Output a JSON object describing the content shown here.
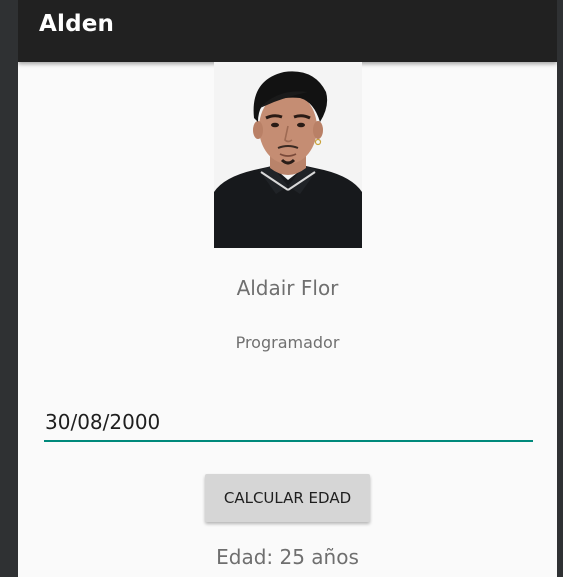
{
  "appbar": {
    "title": "Alden"
  },
  "profile": {
    "name": "Aldair Flor",
    "role": "Programador"
  },
  "form": {
    "birthdate_value": "30/08/2000",
    "calculate_label": "CALCULAR EDAD"
  },
  "result": {
    "text": "Edad: 25 años"
  },
  "colors": {
    "appbar_background": "#212121",
    "screen_background": "#fafafa",
    "input_underline_accent": "#00897b",
    "button_background": "#d6d6d6",
    "secondary_text": "#6f6f6f"
  }
}
